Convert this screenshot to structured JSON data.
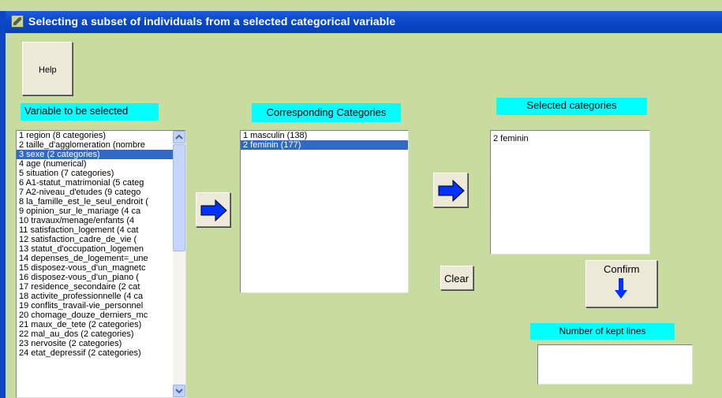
{
  "window": {
    "title": "Selecting a subset of individuals from a selected categorical variable"
  },
  "help_button": {
    "label": "Help"
  },
  "labels": {
    "variable": "Variable to be selected",
    "corresponding": "Corresponding Categories",
    "selected": "Selected categories",
    "kept_lines": "Number of kept lines"
  },
  "variables": [
    "1  region  (8 categories)",
    "2  taille_d'agglomeration  (nombre",
    "3  sexe  (2 categories)",
    "4  age  (numerical)",
    "5  situation  (7 categories)",
    "6  A1-statut_matrimonial  (5 categ",
    "7  A2-niveau_d'etudes  (9 catego",
    "8  la_famille_est_le_seul_endroit  (",
    "9  opinion_sur_le_mariage   (4 ca",
    "10  travaux/menage/enfants   (4",
    "11  satisfaction_logement  (4 cat",
    "12  satisfaction_cadre_de_vie  (",
    "13  statut_d'occupation_logemen",
    "14  depenses_de_logement=_une",
    "15  disposez-vous_d'un_magnetc",
    "16  disposez-vous_d'un_piano  (",
    "17  residence_secondaire  (2 cat",
    "18  activite_professionnelle  (4 ca",
    "19  conflits_travail-vie_personnel",
    "20  chomage_douze_derniers_mc",
    "21  maux_de_tete  (2 categories)",
    "22  mal_au_dos  (2 categories)",
    "23  nervosite  (2 categories)",
    "24  etat_depressif  (2 categories)"
  ],
  "selected_variable_index": 2,
  "corresponding_categories": [
    "1  masculin     (138)",
    "2  feminin      (177)"
  ],
  "selected_category_index": 1,
  "selected_categories": [
    "2  feminin"
  ],
  "clear_button": {
    "label": "Clear"
  },
  "confirm_button": {
    "label": "Confirm"
  },
  "kept_lines_value": "",
  "colors": {
    "label_bg": "#00ffff",
    "window_bg": "#c8dca0",
    "selection": "#316ac5",
    "arrow": "#0033ff"
  }
}
